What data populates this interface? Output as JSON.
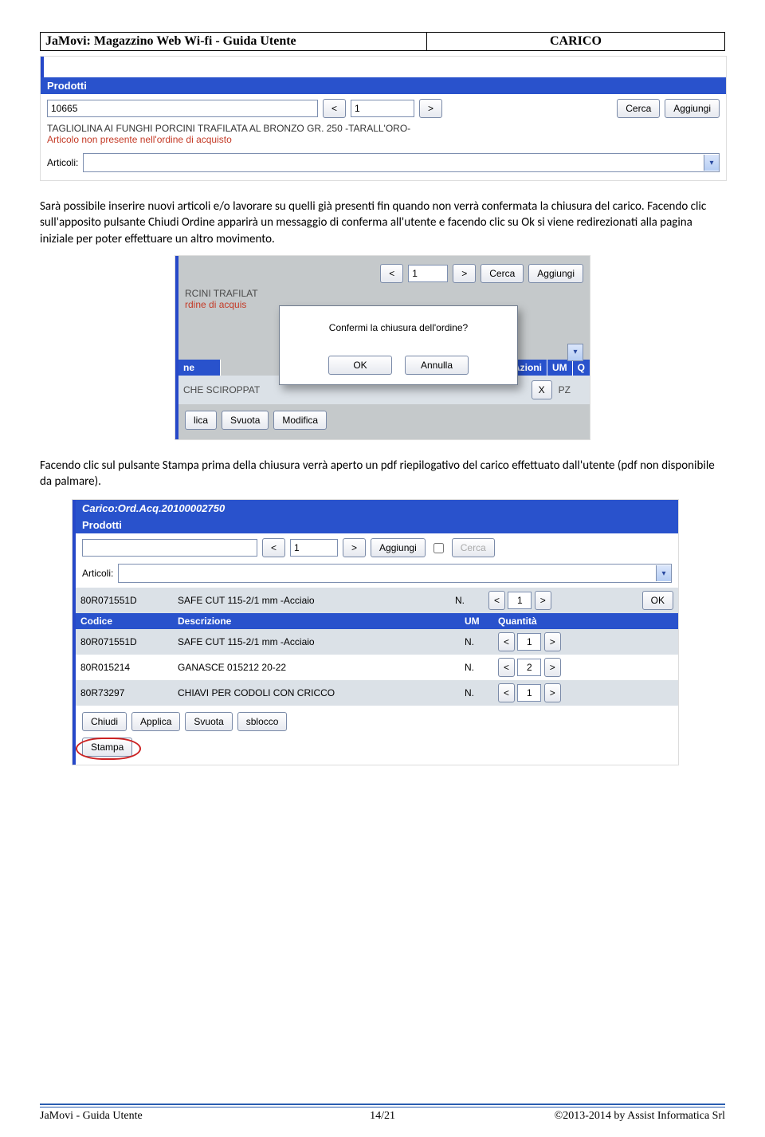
{
  "header": {
    "left": "JaMovi: Magazzino Web Wi-fi  -  Guida Utente",
    "right": "CARICO"
  },
  "shot1": {
    "section_title": "Prodotti",
    "code_value": "10665",
    "qty_value": "1",
    "prev": "<",
    "next": ">",
    "cerca": "Cerca",
    "aggiungi": "Aggiungi",
    "desc": "TAGLIOLINA AI FUNGHI PORCINI TRAFILATA AL BRONZO GR. 250 -TARALL'ORO-",
    "warn": "Articolo non presente nell'ordine di acquisto",
    "articoli_label": "Articoli:"
  },
  "para1": "Sarà possibile inserire nuovi articoli e/o lavorare su quelli già presenti fin quando non verrà confermata la chiusura del carico. Facendo clic sull'apposito pulsante Chiudi Ordine apparirà un messaggio di conferma all'utente e facendo clic su Ok si viene redirezionati alla pagina iniziale per poter effettuare un altro movimento.",
  "shot2": {
    "qty": "1",
    "prev": "<",
    "next": ">",
    "cerca": "Cerca",
    "aggiungi": "Aggiungi",
    "cut_desc": "RCINI TRAFILAT",
    "cut_warn": "rdine di acquis",
    "dialog_text": "Confermi la chiusura dell'ordine?",
    "ok": "OK",
    "annulla": "Annulla",
    "ne": "ne",
    "azioni": "Azioni",
    "um": "UM",
    "q": "Q",
    "row_desc": "CHE SCIROPPAT",
    "x": "X",
    "pz": "PZ",
    "lica": "lica",
    "svuota": "Svuota",
    "modifica": "Modifica"
  },
  "para2": "Facendo clic sul pulsante Stampa prima della chiusura verrà aperto un pdf riepilogativo del carico effettuato dall'utente (pdf non disponibile da palmare).",
  "shot3": {
    "title": "Carico:Ord.Acq.20100002750",
    "prodotti": "Prodotti",
    "qty": "1",
    "prev": "<",
    "next": ">",
    "aggiungi": "Aggiungi",
    "cerca": "Cerca",
    "articoli_label": "Articoli:",
    "firstrow": {
      "code": "80R071551D",
      "desc": "SAFE CUT 115-2/1 mm -Acciaio",
      "n": "N.",
      "qty": "1",
      "ok": "OK"
    },
    "th": {
      "codice": "Codice",
      "descrizione": "Descrizione",
      "um": "UM",
      "qta": "Quantità"
    },
    "rows": [
      {
        "code": "80R071551D",
        "desc": "SAFE CUT 115-2/1 mm -Acciaio",
        "n": "N.",
        "qty": "1"
      },
      {
        "code": "80R015214",
        "desc": "GANASCE 015212 20-22",
        "n": "N.",
        "qty": "2"
      },
      {
        "code": "80R73297",
        "desc": "CHIAVI PER CODOLI CON CRICCO",
        "n": "N.",
        "qty": "1"
      }
    ],
    "buttons": {
      "chiudi": "Chiudi",
      "applica": "Applica",
      "svuota": "Svuota",
      "sblocco": "sblocco",
      "stampa": "Stampa"
    }
  },
  "footer": {
    "left": "JaMovi - Guida Utente",
    "center": "14/21",
    "right": "©2013-2014 by Assist Informatica Srl"
  }
}
